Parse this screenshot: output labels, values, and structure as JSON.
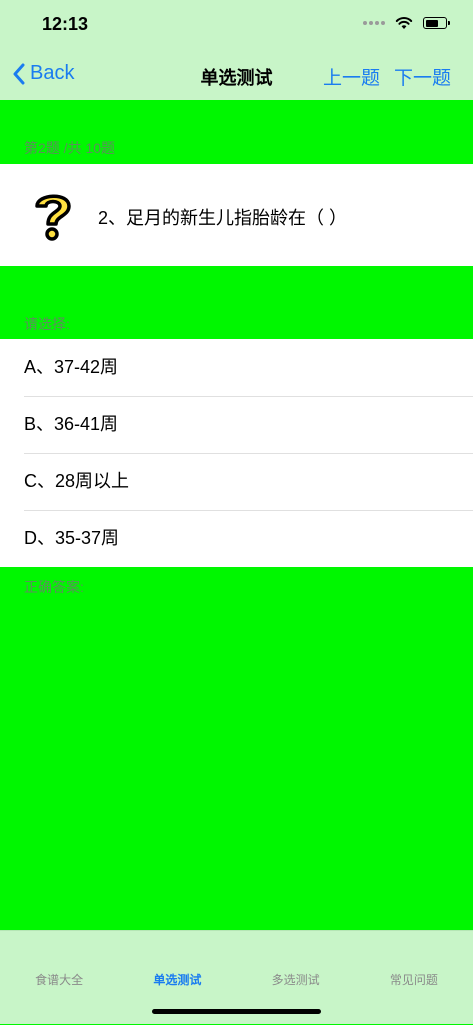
{
  "status_bar": {
    "time": "12:13"
  },
  "nav": {
    "back_label": "Back",
    "title": "单选测试",
    "prev_label": "上一题",
    "next_label": "下一题"
  },
  "question": {
    "progress": "第2题 /共 10题",
    "text": "2、足月的新生儿指胎龄在（   ）"
  },
  "choose_label": "请选择:",
  "options": [
    {
      "label": "A、37-42周"
    },
    {
      "label": "B、36-41周"
    },
    {
      "label": "C、28周以上"
    },
    {
      "label": "D、35-37周"
    }
  ],
  "answer_label": "正确答案:",
  "tabs": [
    {
      "label": "食谱大全",
      "active": false
    },
    {
      "label": "单选测试",
      "active": true
    },
    {
      "label": "多选测试",
      "active": false
    },
    {
      "label": "常见问题",
      "active": false
    }
  ],
  "colors": {
    "accent": "#1a7cf0",
    "background": "#00f700",
    "bar": "#c8f5c8"
  }
}
